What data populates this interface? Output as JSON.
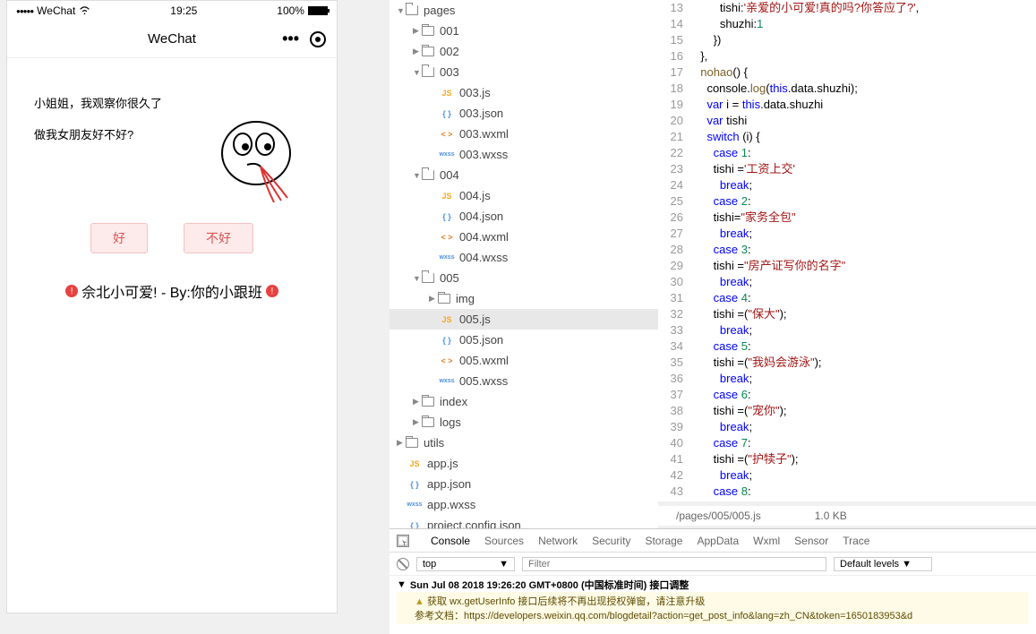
{
  "simulator": {
    "carrier": "WeChat",
    "time": "19:25",
    "battery": "100%",
    "navTitle": "WeChat",
    "line1": "小姐姐，我观察你很久了",
    "line2": "做我女朋友好不好?",
    "btnGood": "好",
    "btnBad": "不好",
    "footer": "佘北小可爱! - By:你的小跟班"
  },
  "tree": [
    {
      "d": 0,
      "t": "folder",
      "a": "down",
      "n": "pages",
      "open": true
    },
    {
      "d": 1,
      "t": "folder",
      "a": "right",
      "n": "001"
    },
    {
      "d": 1,
      "t": "folder",
      "a": "right",
      "n": "002"
    },
    {
      "d": 1,
      "t": "folder",
      "a": "down",
      "n": "003",
      "open": true
    },
    {
      "d": 2,
      "t": "file",
      "ic": "JS",
      "cls": "js-icon",
      "n": "003.js"
    },
    {
      "d": 2,
      "t": "file",
      "ic": "{ }",
      "cls": "json-icon",
      "n": "003.json"
    },
    {
      "d": 2,
      "t": "file",
      "ic": "< >",
      "cls": "wxml-icon",
      "n": "003.wxml"
    },
    {
      "d": 2,
      "t": "file",
      "ic": "wxss",
      "cls": "wxss-icon",
      "n": "003.wxss"
    },
    {
      "d": 1,
      "t": "folder",
      "a": "down",
      "n": "004",
      "open": true
    },
    {
      "d": 2,
      "t": "file",
      "ic": "JS",
      "cls": "js-icon",
      "n": "004.js"
    },
    {
      "d": 2,
      "t": "file",
      "ic": "{ }",
      "cls": "json-icon",
      "n": "004.json"
    },
    {
      "d": 2,
      "t": "file",
      "ic": "< >",
      "cls": "wxml-icon",
      "n": "004.wxml"
    },
    {
      "d": 2,
      "t": "file",
      "ic": "wxss",
      "cls": "wxss-icon",
      "n": "004.wxss"
    },
    {
      "d": 1,
      "t": "folder",
      "a": "down",
      "n": "005",
      "open": true
    },
    {
      "d": 2,
      "t": "folder",
      "a": "right",
      "n": "img"
    },
    {
      "d": 2,
      "t": "file",
      "ic": "JS",
      "cls": "js-icon",
      "n": "005.js",
      "sel": true
    },
    {
      "d": 2,
      "t": "file",
      "ic": "{ }",
      "cls": "json-icon",
      "n": "005.json"
    },
    {
      "d": 2,
      "t": "file",
      "ic": "< >",
      "cls": "wxml-icon",
      "n": "005.wxml"
    },
    {
      "d": 2,
      "t": "file",
      "ic": "wxss",
      "cls": "wxss-icon",
      "n": "005.wxss"
    },
    {
      "d": 1,
      "t": "folder",
      "a": "right",
      "n": "index"
    },
    {
      "d": 1,
      "t": "folder",
      "a": "right",
      "n": "logs"
    },
    {
      "d": 0,
      "t": "folder",
      "a": "right",
      "n": "utils"
    },
    {
      "d": 0,
      "t": "file",
      "ic": "JS",
      "cls": "js-icon",
      "n": "app.js",
      "noarrow": true
    },
    {
      "d": 0,
      "t": "file",
      "ic": "{ }",
      "cls": "json-icon",
      "n": "app.json",
      "noarrow": true
    },
    {
      "d": 0,
      "t": "file",
      "ic": "wxss",
      "cls": "wxss-icon",
      "n": "app.wxss",
      "noarrow": true
    },
    {
      "d": 0,
      "t": "file",
      "ic": "{ }",
      "cls": "json-icon",
      "n": "project.config.json",
      "noarrow": true
    }
  ],
  "code": {
    "start": 13,
    "lines": [
      [
        [
          "        tishi:",
          ""
        ],
        [
          "'亲爱的小可爱!真的吗?你答应了?'",
          "str"
        ],
        [
          ",",
          ""
        ]
      ],
      [
        [
          "        shuzhi:",
          ""
        ],
        [
          "1",
          "num"
        ]
      ],
      [
        [
          "      })",
          ""
        ]
      ],
      [
        [
          "  },",
          ""
        ]
      ],
      [
        [
          "  ",
          ""
        ],
        [
          "nohao",
          "fn"
        ],
        [
          "() {",
          ""
        ]
      ],
      [
        [
          "    console.",
          ""
        ],
        [
          "log",
          "fn"
        ],
        [
          "(",
          ""
        ],
        [
          "this",
          "kw"
        ],
        [
          ".data.shuzhi);",
          ""
        ]
      ],
      [
        [
          "    ",
          ""
        ],
        [
          "var",
          "kw"
        ],
        [
          " i = ",
          ""
        ],
        [
          "this",
          "kw"
        ],
        [
          ".data.shuzhi",
          ""
        ]
      ],
      [
        [
          "    ",
          ""
        ],
        [
          "var",
          "kw"
        ],
        [
          " tishi",
          ""
        ]
      ],
      [
        [
          "    ",
          ""
        ],
        [
          "switch",
          "kw"
        ],
        [
          " (i) {",
          ""
        ]
      ],
      [
        [
          "      ",
          ""
        ],
        [
          "case",
          "kw"
        ],
        [
          " ",
          ""
        ],
        [
          "1",
          "num"
        ],
        [
          ":",
          ""
        ]
      ],
      [
        [
          "      tishi =",
          ""
        ],
        [
          "'工资上交'",
          "str"
        ]
      ],
      [
        [
          "        ",
          ""
        ],
        [
          "break",
          "kw"
        ],
        [
          ";",
          ""
        ]
      ],
      [
        [
          "      ",
          ""
        ],
        [
          "case",
          "kw"
        ],
        [
          " ",
          ""
        ],
        [
          "2",
          "num"
        ],
        [
          ":",
          ""
        ]
      ],
      [
        [
          "      tishi=",
          ""
        ],
        [
          "\"家务全包\"",
          "str"
        ]
      ],
      [
        [
          "        ",
          ""
        ],
        [
          "break",
          "kw"
        ],
        [
          ";",
          ""
        ]
      ],
      [
        [
          "      ",
          ""
        ],
        [
          "case",
          "kw"
        ],
        [
          " ",
          ""
        ],
        [
          "3",
          "num"
        ],
        [
          ":",
          ""
        ]
      ],
      [
        [
          "      tishi =",
          ""
        ],
        [
          "\"房产证写你的名字\"",
          "str"
        ]
      ],
      [
        [
          "        ",
          ""
        ],
        [
          "break",
          "kw"
        ],
        [
          ";",
          ""
        ]
      ],
      [
        [
          "      ",
          ""
        ],
        [
          "case",
          "kw"
        ],
        [
          " ",
          ""
        ],
        [
          "4",
          "num"
        ],
        [
          ":",
          ""
        ]
      ],
      [
        [
          "      tishi =(",
          ""
        ],
        [
          "\"保大\"",
          "str"
        ],
        [
          ");",
          ""
        ]
      ],
      [
        [
          "        ",
          ""
        ],
        [
          "break",
          "kw"
        ],
        [
          ";",
          ""
        ]
      ],
      [
        [
          "      ",
          ""
        ],
        [
          "case",
          "kw"
        ],
        [
          " ",
          ""
        ],
        [
          "5",
          "num"
        ],
        [
          ":",
          ""
        ]
      ],
      [
        [
          "      tishi =(",
          ""
        ],
        [
          "\"我妈会游泳\"",
          "str"
        ],
        [
          ");",
          ""
        ]
      ],
      [
        [
          "        ",
          ""
        ],
        [
          "break",
          "kw"
        ],
        [
          ";",
          ""
        ]
      ],
      [
        [
          "      ",
          ""
        ],
        [
          "case",
          "kw"
        ],
        [
          " ",
          ""
        ],
        [
          "6",
          "num"
        ],
        [
          ":",
          ""
        ]
      ],
      [
        [
          "      tishi =(",
          ""
        ],
        [
          "\"宠你\"",
          "str"
        ],
        [
          ");",
          ""
        ]
      ],
      [
        [
          "        ",
          ""
        ],
        [
          "break",
          "kw"
        ],
        [
          ";",
          ""
        ]
      ],
      [
        [
          "      ",
          ""
        ],
        [
          "case",
          "kw"
        ],
        [
          " ",
          ""
        ],
        [
          "7",
          "num"
        ],
        [
          ":",
          ""
        ]
      ],
      [
        [
          "      tishi =(",
          ""
        ],
        [
          "\"护犊子\"",
          "str"
        ],
        [
          ");",
          ""
        ]
      ],
      [
        [
          "        ",
          ""
        ],
        [
          "break",
          "kw"
        ],
        [
          ";",
          ""
        ]
      ],
      [
        [
          "      ",
          ""
        ],
        [
          "case",
          "kw"
        ],
        [
          " ",
          ""
        ],
        [
          "8",
          "num"
        ],
        [
          ":",
          ""
        ]
      ]
    ]
  },
  "statusFile": {
    "path": "/pages/005/005.js",
    "size": "1.0 KB"
  },
  "console": {
    "tabs": [
      "Console",
      "Sources",
      "Network",
      "Security",
      "Storage",
      "AppData",
      "Wxml",
      "Sensor",
      "Trace"
    ],
    "context": "top",
    "filterPlaceholder": "Filter",
    "levels": "Default levels ▼",
    "msgTime": "Sun Jul 08 2018 19:26:20 GMT+0800 (中国标准时间) 接口调整",
    "warnLine": "获取 wx.getUserInfo 接口后续将不再出现授权弹窗，请注意升级",
    "docLabel": "参考文档：",
    "docLink": "https://developers.weixin.qq.com/blogdetail?action=get_post_info&lang=zh_CN&token=1650183953&d"
  }
}
